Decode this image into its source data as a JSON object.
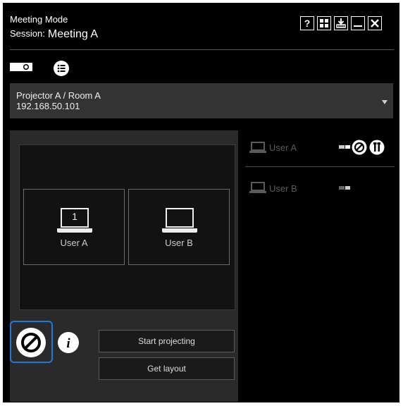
{
  "header": {
    "title": "Meeting Mode",
    "session_label": "Session:",
    "session_name": "Meeting A"
  },
  "toolbar": {
    "help_label": "?",
    "icons": [
      "help-icon",
      "grid-icon",
      "download-icon",
      "minimize-icon",
      "close-icon"
    ]
  },
  "projector_select": {
    "name": "Projector A / Room A",
    "ip": "192.168.50.101"
  },
  "layout": {
    "slots": [
      {
        "number": "1",
        "label": "User A"
      },
      {
        "label": "User B"
      }
    ]
  },
  "buttons": {
    "start_projecting": "Start projecting",
    "get_layout": "Get layout"
  },
  "users": [
    {
      "name": "User A"
    },
    {
      "name": "User B"
    }
  ],
  "colors": {
    "background": "#000000",
    "panel": "#2a2a2a",
    "selector": "#333333",
    "focus_ring": "#1e78dc",
    "dim_text": "#5a5a5a"
  }
}
